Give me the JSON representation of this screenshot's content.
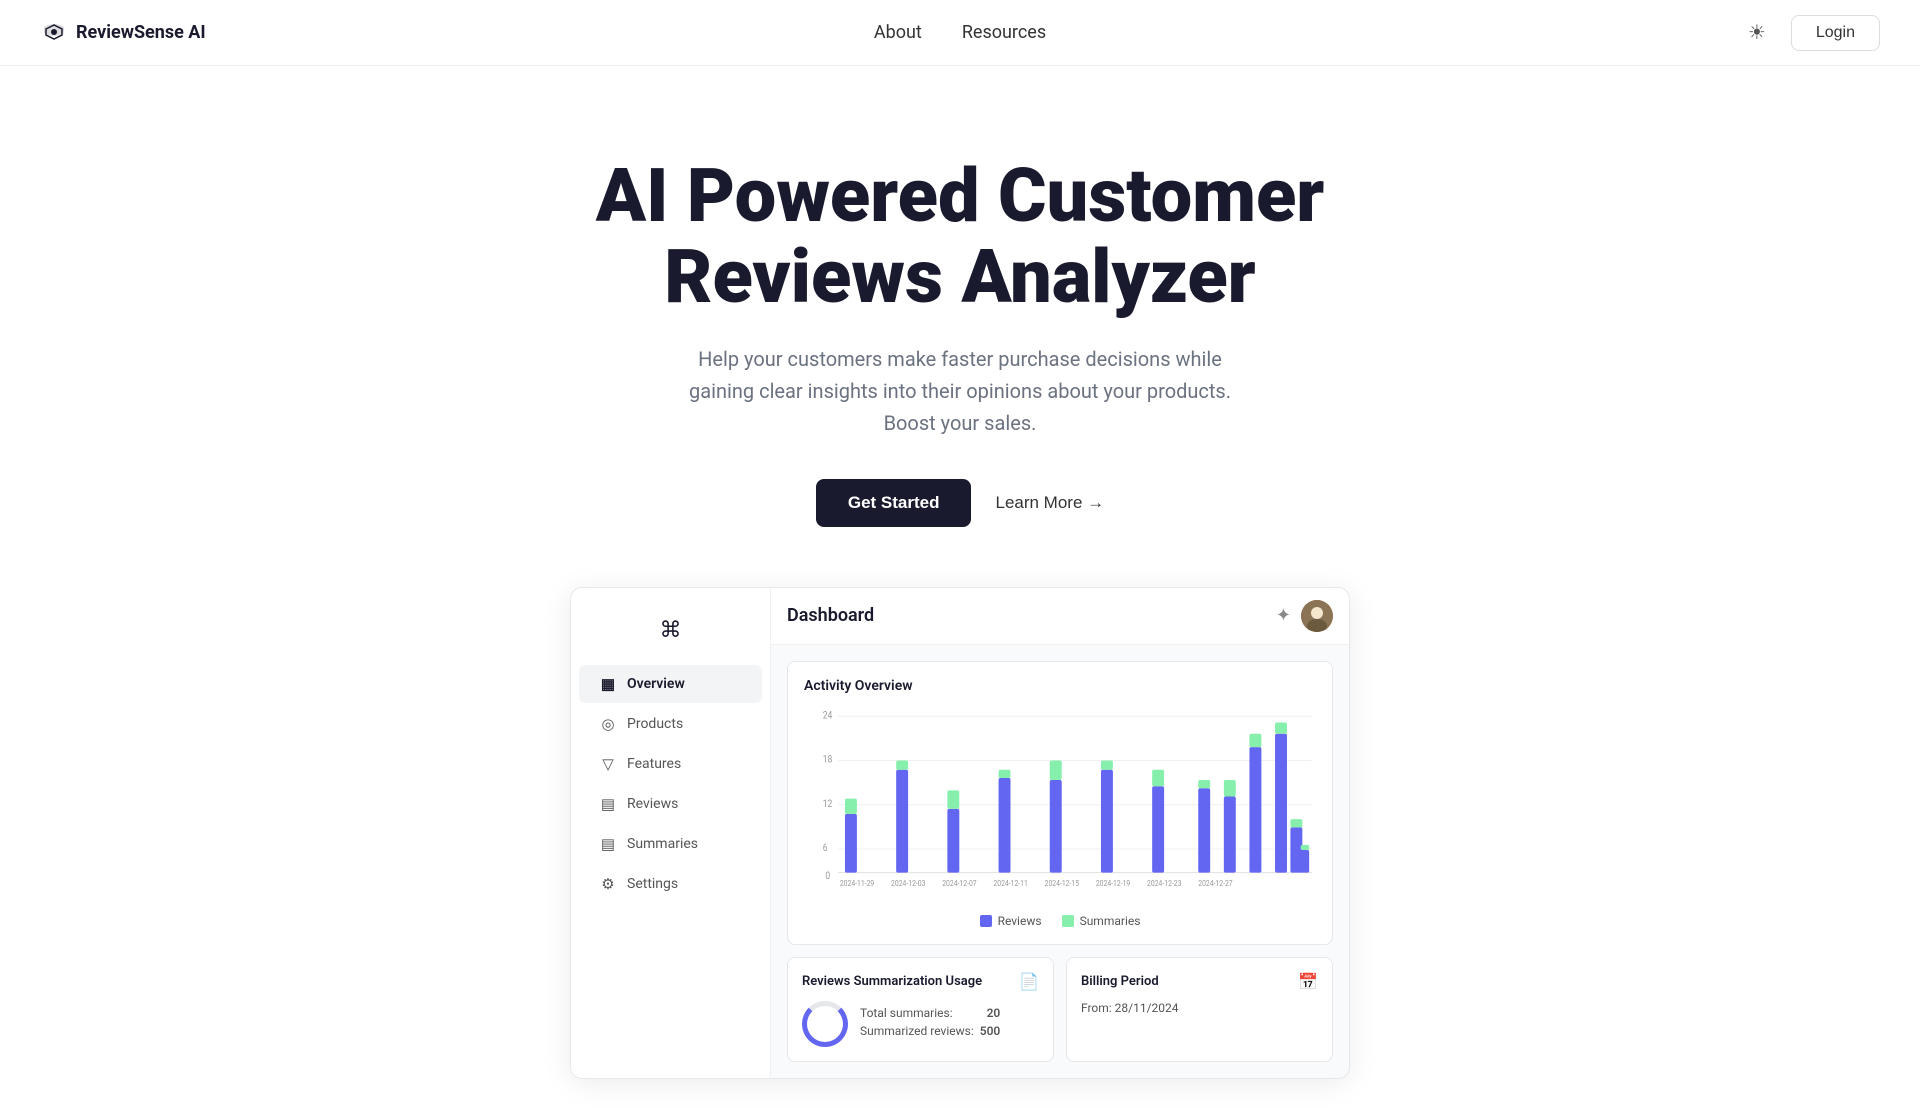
{
  "brand": {
    "name": "ReviewSense AI",
    "logo_symbol": "⌘"
  },
  "nav": {
    "links": [
      {
        "label": "About",
        "id": "about"
      },
      {
        "label": "Resources",
        "id": "resources"
      }
    ],
    "theme_icon": "☀",
    "login_label": "Login"
  },
  "hero": {
    "title": "AI Powered Customer Reviews Analyzer",
    "subtitle": "Help your customers make faster purchase decisions while gaining clear insights into their opinions about your products. Boost your sales.",
    "cta_primary": "Get Started",
    "cta_secondary": "Learn More →"
  },
  "dashboard": {
    "title": "Dashboard",
    "header_icon": "✦",
    "sidebar_logo": "⌘",
    "sidebar_items": [
      {
        "label": "Overview",
        "icon": "▦",
        "active": true
      },
      {
        "label": "Products",
        "icon": "◎"
      },
      {
        "label": "Features",
        "icon": "▽"
      },
      {
        "label": "Reviews",
        "icon": "▤"
      },
      {
        "label": "Summaries",
        "icon": "▤"
      },
      {
        "label": "Settings",
        "icon": "⚙"
      }
    ],
    "chart": {
      "title": "Activity Overview",
      "legend": [
        {
          "label": "Reviews",
          "color": "#6366f1"
        },
        {
          "label": "Summaries",
          "color": "#86efac"
        }
      ],
      "y_labels": [
        "24",
        "18",
        "12",
        "6",
        "0"
      ],
      "x_labels": [
        "2024-11-29",
        "2024-12-03",
        "2024-12-07",
        "2024-12-11",
        "2024-12-15",
        "2024-12-19",
        "2024-12-23",
        "2024-12-27"
      ]
    },
    "usage_card": {
      "title": "Reviews Summarization Usage",
      "total_summaries_label": "Total summaries:",
      "total_summaries_value": "20",
      "summarized_reviews_label": "Summarized reviews:",
      "summarized_reviews_value": "500"
    },
    "billing_card": {
      "title": "Billing Period",
      "from_label": "From: 28/11/2024"
    }
  }
}
